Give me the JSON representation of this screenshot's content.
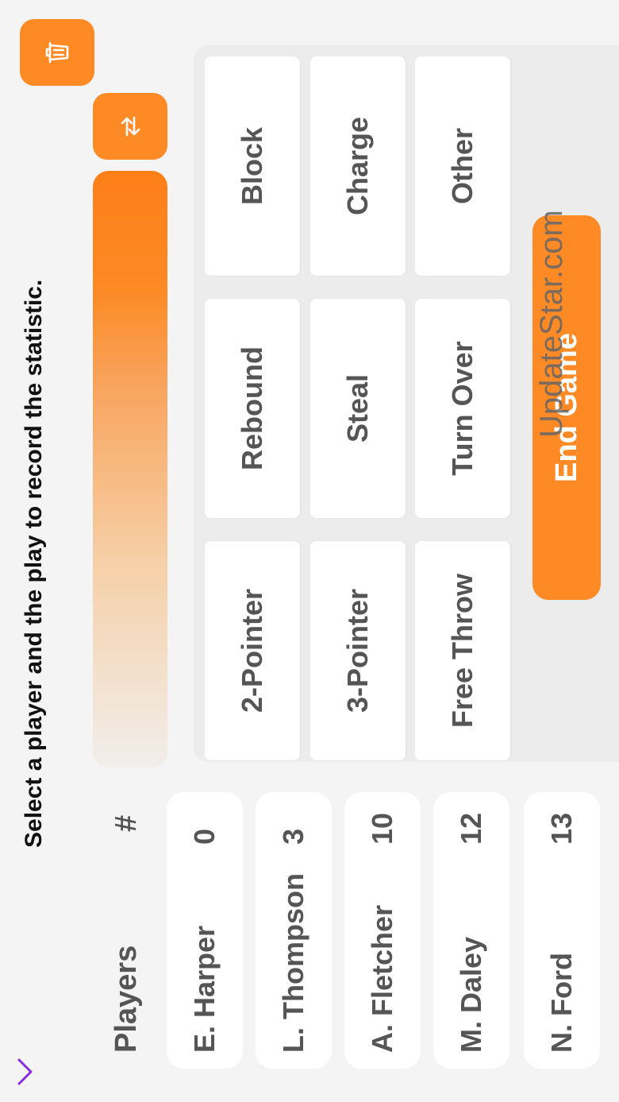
{
  "header": {
    "instruction": "Select a player and the play to record the statistic."
  },
  "players": {
    "header_label": "Players",
    "number_header": "#",
    "list": [
      {
        "name": "E. Harper",
        "number": "0"
      },
      {
        "name": "L. Thompson",
        "number": "3"
      },
      {
        "name": "A. Fletcher",
        "number": "10"
      },
      {
        "name": "M. Daley",
        "number": "12"
      },
      {
        "name": "N. Ford",
        "number": "13"
      }
    ]
  },
  "stats": {
    "row1": [
      "2-Pointer",
      "Rebound",
      "Block"
    ],
    "row2": [
      "3-Pointer",
      "Steal",
      "Charge"
    ],
    "row3": [
      "Free Throw",
      "Turn Over",
      "Other"
    ]
  },
  "actions": {
    "end_game": "End Game"
  },
  "watermark": "UpdateStar.com",
  "icons": {
    "collapse": "chevron-down-icon",
    "info": "info-icon",
    "swap": "swap-icon",
    "trash": "trash-icon"
  },
  "colors": {
    "accent": "#fd8a25",
    "info": "#8a2be2",
    "text": "#555555"
  }
}
